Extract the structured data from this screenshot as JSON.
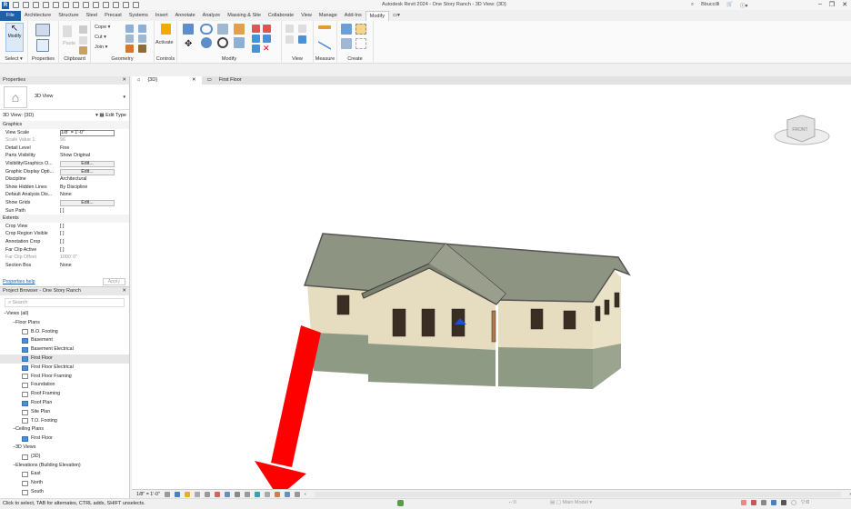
{
  "app": {
    "title": "Autodesk Revit 2024 - One Story Ranch - 3D View: {3D}",
    "user": "Bbuccilli",
    "logo": "R"
  },
  "tabs": [
    "File",
    "Architecture",
    "Structure",
    "Steel",
    "Precast",
    "Systems",
    "Insert",
    "Annotate",
    "Analyze",
    "Massing & Site",
    "Collaborate",
    "View",
    "Manage",
    "Add-Ins",
    "Modify"
  ],
  "ribbon": {
    "panels": [
      "Select ▾",
      "Properties",
      "Clipboard",
      "Geometry",
      "Controls",
      "Modify",
      "View",
      "Measure",
      "Create"
    ],
    "buttons": {
      "modify": "Modify",
      "paste": "Paste",
      "cope": "Cope ▾",
      "cut": "Cut ▾",
      "join": "Join ▾",
      "activate": "Activate"
    }
  },
  "properties": {
    "header": "Properties",
    "type_name": "3D View",
    "selector": "3D View: {3D}",
    "edit_type": "Edit Type",
    "groups": [
      {
        "name": "Graphics",
        "rows": [
          [
            "View Scale",
            "1/8\" = 1'-0\""
          ],
          [
            "Scale Value    1:",
            "96"
          ],
          [
            "Detail Level",
            "Fine"
          ],
          [
            "Parts Visibility",
            "Show Original"
          ],
          [
            "Visibility/Graphics O...",
            "Edit..."
          ],
          [
            "Graphic Display Opti...",
            "Edit..."
          ],
          [
            "Discipline",
            "Architectural"
          ],
          [
            "Show Hidden Lines",
            "By Discipline"
          ],
          [
            "Default Analysis Dis...",
            "None"
          ],
          [
            "Show Grids",
            "Edit..."
          ],
          [
            "Sun Path",
            "[ ]"
          ]
        ]
      },
      {
        "name": "Extents",
        "rows": [
          [
            "Crop View",
            "[ ]"
          ],
          [
            "Crop Region Visible",
            "[ ]"
          ],
          [
            "Annotation Crop",
            "[ ]"
          ],
          [
            "Far Clip Active",
            "[ ]"
          ],
          [
            "Far Clip Offset",
            "1000'  0\""
          ],
          [
            "Section Box",
            "None"
          ]
        ]
      }
    ],
    "help_link": "Properties help",
    "apply": "Apply"
  },
  "browser": {
    "header": "Project Browser - One Story Ranch",
    "search_placeholder": "Search",
    "tree": [
      {
        "label": "Views (all)",
        "level": 0,
        "type": "root"
      },
      {
        "label": "Floor Plans",
        "level": 1,
        "type": "group"
      },
      {
        "label": "B.O. Footing",
        "level": 2,
        "on": false
      },
      {
        "label": "Basement",
        "level": 2,
        "on": true
      },
      {
        "label": "Basement Electrical",
        "level": 2,
        "on": true
      },
      {
        "label": "First Floor",
        "level": 2,
        "on": true,
        "selected": true
      },
      {
        "label": "First Floor Electrical",
        "level": 2,
        "on": true
      },
      {
        "label": "First Floor Framing",
        "level": 2,
        "on": false
      },
      {
        "label": "Foundation",
        "level": 2,
        "on": false
      },
      {
        "label": "Roof Framing",
        "level": 2,
        "on": false
      },
      {
        "label": "Roof Plan",
        "level": 2,
        "on": true
      },
      {
        "label": "Site Plan",
        "level": 2,
        "on": false
      },
      {
        "label": "T.O. Footing",
        "level": 2,
        "on": false
      },
      {
        "label": "Ceiling Plans",
        "level": 1,
        "type": "group"
      },
      {
        "label": "First Floor",
        "level": 2,
        "on": true
      },
      {
        "label": "3D Views",
        "level": 1,
        "type": "group"
      },
      {
        "label": "{3D}",
        "level": 2,
        "on": false
      },
      {
        "label": "Elevations (Building Elevation)",
        "level": 1,
        "type": "group"
      },
      {
        "label": "East",
        "level": 2,
        "on": false
      },
      {
        "label": "North",
        "level": 2,
        "on": false
      },
      {
        "label": "South",
        "level": 2,
        "on": false
      }
    ]
  },
  "view_tabs": [
    {
      "label": "{3D}",
      "active": true
    },
    {
      "label": "First Floor",
      "active": false
    }
  ],
  "viewcube": {
    "face": "FRONT"
  },
  "view_control": {
    "scale": "1/8\" = 1'-0\""
  },
  "status": {
    "text": "Click to select, TAB for alternates, CTRL adds, SHIFT unselects.",
    "model": "Main Model",
    "selected_count": ":0",
    "filter_count": ":0"
  },
  "colors": {
    "accent": "#1f5fa8",
    "arrow": "#ff0000",
    "roof": "#8e9482",
    "wall": "#e6dcc0",
    "base": "#8f9a84"
  }
}
